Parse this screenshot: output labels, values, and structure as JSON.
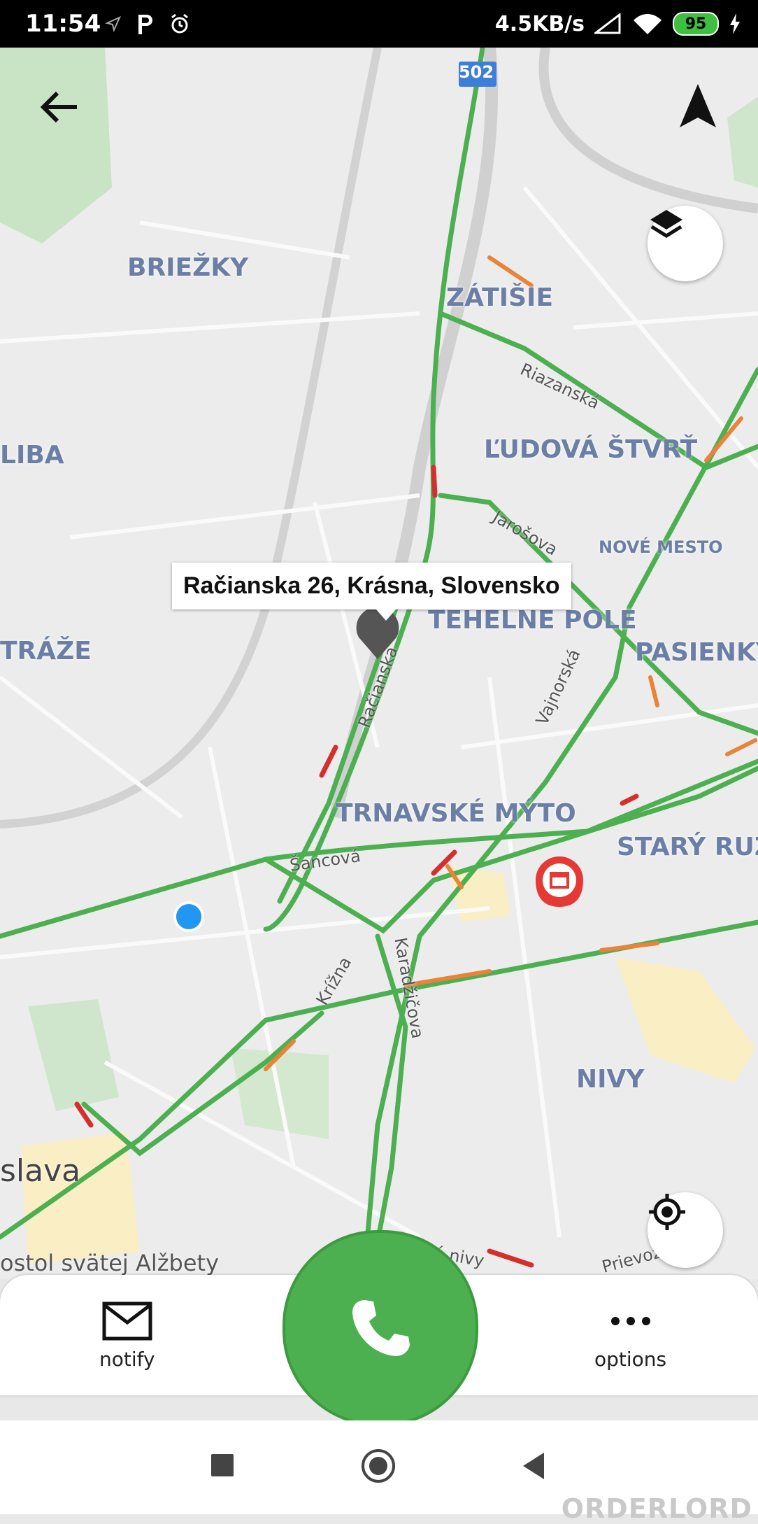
{
  "status_bar": {
    "time": "11:54",
    "network_speed": "4.5KB/s",
    "battery": "95",
    "icons": [
      "location-arrow-icon",
      "parking-icon",
      "alarm-icon",
      "signal-icon",
      "wifi-icon",
      "charging-icon"
    ]
  },
  "map": {
    "address_tooltip": "Račianska 26, Krásna, Slovensko",
    "road_badge": "502",
    "districts": [
      "BRIEŽKY",
      "ZÁTIŠIE",
      "ĽUDOVÁ ŠTVRŤ",
      "LIBA",
      "NOVÉ MESTO",
      "TEHELNÉ POLE",
      "PASIENKY",
      "TRÁŽE",
      "TRNAVSKÉ MÝTO",
      "STARÝ RUŽ",
      "NIVY",
      "slava"
    ],
    "streets": [
      "Riazanská",
      "Jarošova",
      "Račianska",
      "Vajnorská",
      "Šancová",
      "Krížna",
      "Karadžičova",
      "Prievoz",
      "é nivy"
    ],
    "poi": "ostol svätej Alžbety"
  },
  "bottom_sheet": {
    "notify_label": "notify",
    "options_label": "options"
  },
  "watermark": "ORDERLORD",
  "colors": {
    "traffic_green": "#4caf50",
    "traffic_orange": "#e8833a",
    "traffic_red": "#d32f2f",
    "call_button": "#4caf50"
  }
}
